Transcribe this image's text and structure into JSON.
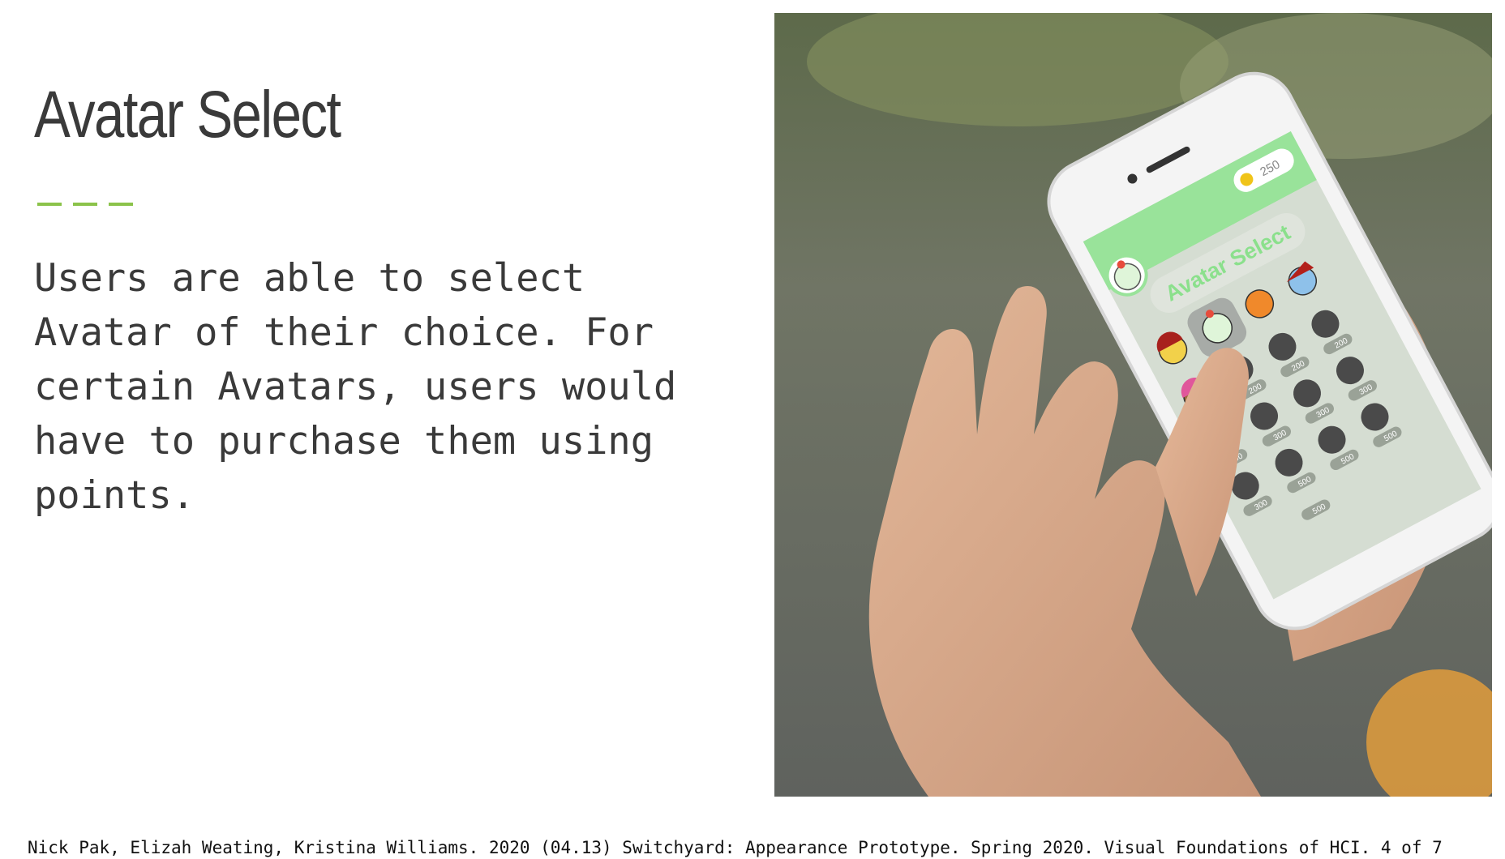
{
  "slide": {
    "title": "Avatar Select",
    "body": "Users are able to select Avatar of their choice. For certain Avatars, users would have to purchase them using points.",
    "footer": "Nick Pak, Elizah Weating, Kristina Williams. 2020 (04.13) Switchyard: Appearance Prototype. Spring 2020. Visual Foundations of HCI. 4 of 7"
  },
  "phone_screen": {
    "points": "250",
    "title": "Avatar Select",
    "prices": [
      "200",
      "200",
      "200",
      "200",
      "300",
      "300",
      "300",
      "300",
      "500",
      "500",
      "500",
      "500"
    ]
  },
  "colors": {
    "accent": "#8bc34a",
    "screen_header": "#99e39a",
    "screen_title": "#8be08c",
    "screen_bg": "#d5ddd2",
    "locked_avatar": "#4a4a4a"
  }
}
